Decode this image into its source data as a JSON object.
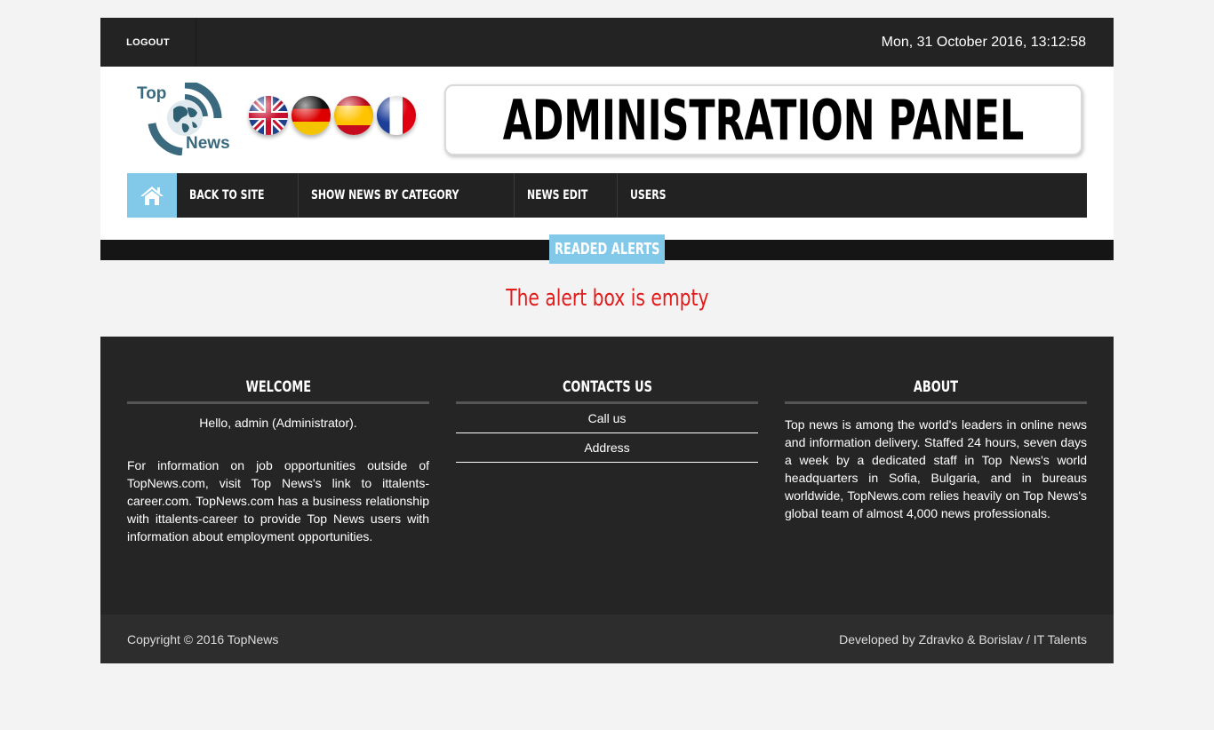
{
  "topbar": {
    "logout_label": "LOGOUT",
    "datetime": "Mon, 31 October 2016, 13:12:58"
  },
  "header": {
    "logo_top": "Top",
    "logo_news": "News",
    "banner_title": "ADMINISTRATION PANEL",
    "flags": [
      "uk-flag-icon",
      "germany-flag-icon",
      "spain-flag-icon",
      "france-flag-icon"
    ]
  },
  "nav": {
    "home_icon": "home-icon",
    "items": [
      {
        "label": "BACK TO SITE"
      },
      {
        "label": "SHOW NEWS BY CATEGORY"
      },
      {
        "label": "NEWS EDIT"
      },
      {
        "label": "USERS"
      }
    ]
  },
  "section": {
    "label": "READED ALERTS",
    "message": "The alert box is empty"
  },
  "footer": {
    "welcome": {
      "heading": "WELCOME",
      "hello": "Hello, admin (Administrator).",
      "text": "For information on job opportunities outside of TopNews.com, visit Top News's link to ittalents-career.com. TopNews.com has a business relationship with ittalents-career to provide Top News users with information about employment opportunities."
    },
    "contacts": {
      "heading": "CONTACTS US",
      "links": [
        "Call us",
        "Address"
      ]
    },
    "about": {
      "heading": "ABOUT",
      "text": "Top news is among the world's leaders in online news and information delivery. Staffed 24 hours, seven days a week by a dedicated staff in Top News's world headquarters in Sofia, Bulgaria, and in bureaus worldwide, TopNews.com relies heavily on Top News's global team of almost 4,000 news professionals."
    },
    "copyright": "Copyright © 2016 TopNews",
    "developed_by": "Developed by Zdravko & Borislav / IT Talents"
  },
  "colors": {
    "accent": "#82c8e8",
    "dark_bar": "#232323",
    "alert_red": "#e21b1b"
  }
}
